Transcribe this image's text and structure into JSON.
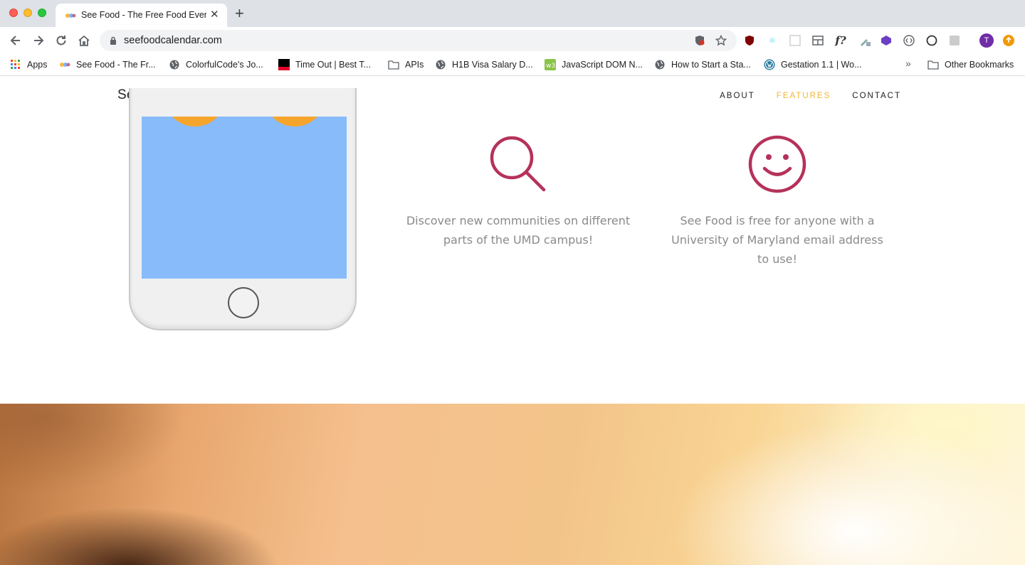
{
  "browser": {
    "tab_title": "See Food - The Free Food Events",
    "url": "seefoodcalendar.com",
    "bookmarks": [
      {
        "label": "Apps",
        "icon": "apps-grid-icon"
      },
      {
        "label": "See Food - The Fr...",
        "icon": "seefood-favicon-icon"
      },
      {
        "label": "ColorfulCode's Jo...",
        "icon": "globe-icon"
      },
      {
        "label": "Time Out | Best T...",
        "icon": "timeout-favicon-icon"
      },
      {
        "label": "APIs",
        "icon": "folder-icon"
      },
      {
        "label": "H1B Visa Salary D...",
        "icon": "globe-icon"
      },
      {
        "label": "JavaScript DOM N...",
        "icon": "w3-favicon-icon"
      },
      {
        "label": "How to Start a Sta...",
        "icon": "globe-icon"
      },
      {
        "label": "Gestation 1.1 | Wo...",
        "icon": "wordpress-icon"
      }
    ],
    "other_bookmarks": "Other Bookmarks",
    "profile_initial": "T"
  },
  "site": {
    "brand": "See Food",
    "nav": [
      {
        "label": "ABOUT",
        "active": false
      },
      {
        "label": "FEATURES",
        "active": true
      },
      {
        "label": "CONTACT",
        "active": false
      }
    ],
    "features": [
      {
        "icon": "magnifier-icon",
        "text_line1": "Discover new communities on different",
        "text_line2": "parts of the UMD campus!",
        "text_line3": ""
      },
      {
        "icon": "smiley-icon",
        "text_line1": "See Food is free for anyone with a",
        "text_line2": "University of Maryland email address",
        "text_line3": "to use!"
      }
    ]
  },
  "colors": {
    "accent": "#f2b632",
    "icon": "#b5325a",
    "phone_screen": "#88bbfa"
  }
}
